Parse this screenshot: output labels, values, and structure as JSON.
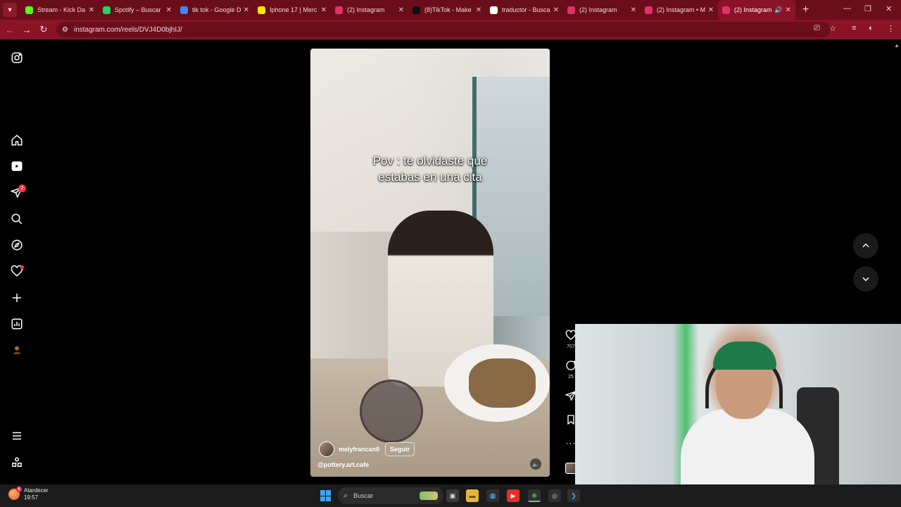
{
  "browser": {
    "tabs": [
      {
        "label": "Stream - Kick Da",
        "favicon": "kick-icon",
        "color": "#53fc18",
        "active": false
      },
      {
        "label": "Spotify – Buscar",
        "favicon": "spotify-icon",
        "color": "#1ed760",
        "active": false
      },
      {
        "label": "tik tok - Google D",
        "favicon": "google-drive-icon",
        "color": "#4285f4",
        "active": false
      },
      {
        "label": "Iphone 17 | Merc",
        "favicon": "mercadolibre-icon",
        "color": "#ffe600",
        "active": false
      },
      {
        "label": "(2) Instagram",
        "favicon": "instagram-icon",
        "color": "#e1306c",
        "active": false
      },
      {
        "label": "(8)TikTok - Make",
        "favicon": "tiktok-icon",
        "color": "#111111",
        "active": false
      },
      {
        "label": "traductor - Buscar",
        "favicon": "google-icon",
        "color": "#ffffff",
        "active": false
      },
      {
        "label": "(2) Instagram",
        "favicon": "instagram-icon",
        "color": "#e1306c",
        "active": false
      },
      {
        "label": "(2) Instagram • M",
        "favicon": "instagram-icon",
        "color": "#e1306c",
        "active": false
      },
      {
        "label": "(2) Instagram",
        "favicon": "instagram-icon",
        "color": "#e1306c",
        "active": true
      }
    ],
    "url": "instagram.com/reels/DVJ4D0bjhIJ/",
    "theme_color": "#8a1326"
  },
  "sidebar": {
    "items": [
      {
        "name": "instagram-logo-icon"
      },
      {
        "name": "home-icon"
      },
      {
        "name": "reels-icon"
      },
      {
        "name": "messages-icon",
        "badge": "2"
      },
      {
        "name": "search-icon"
      },
      {
        "name": "explore-icon"
      },
      {
        "name": "notifications-icon",
        "has_dot": true
      },
      {
        "name": "create-icon"
      },
      {
        "name": "dashboard-icon"
      },
      {
        "name": "profile-avatar"
      },
      {
        "name": "menu-icon"
      },
      {
        "name": "meta-apps-icon"
      }
    ]
  },
  "reel": {
    "caption_line1": "Pov : te olvidaste que",
    "caption_line2": "estabas en una cita",
    "username": "melyfrancan0",
    "follow_label": "Seguir",
    "location_tag": "@pottery.art.cafe",
    "likes": "707",
    "comments": "25"
  },
  "taskbar": {
    "weather_label": "Atardecer",
    "weather_time": "19:57",
    "weather_badge": "6",
    "search_placeholder": "Buscar"
  }
}
